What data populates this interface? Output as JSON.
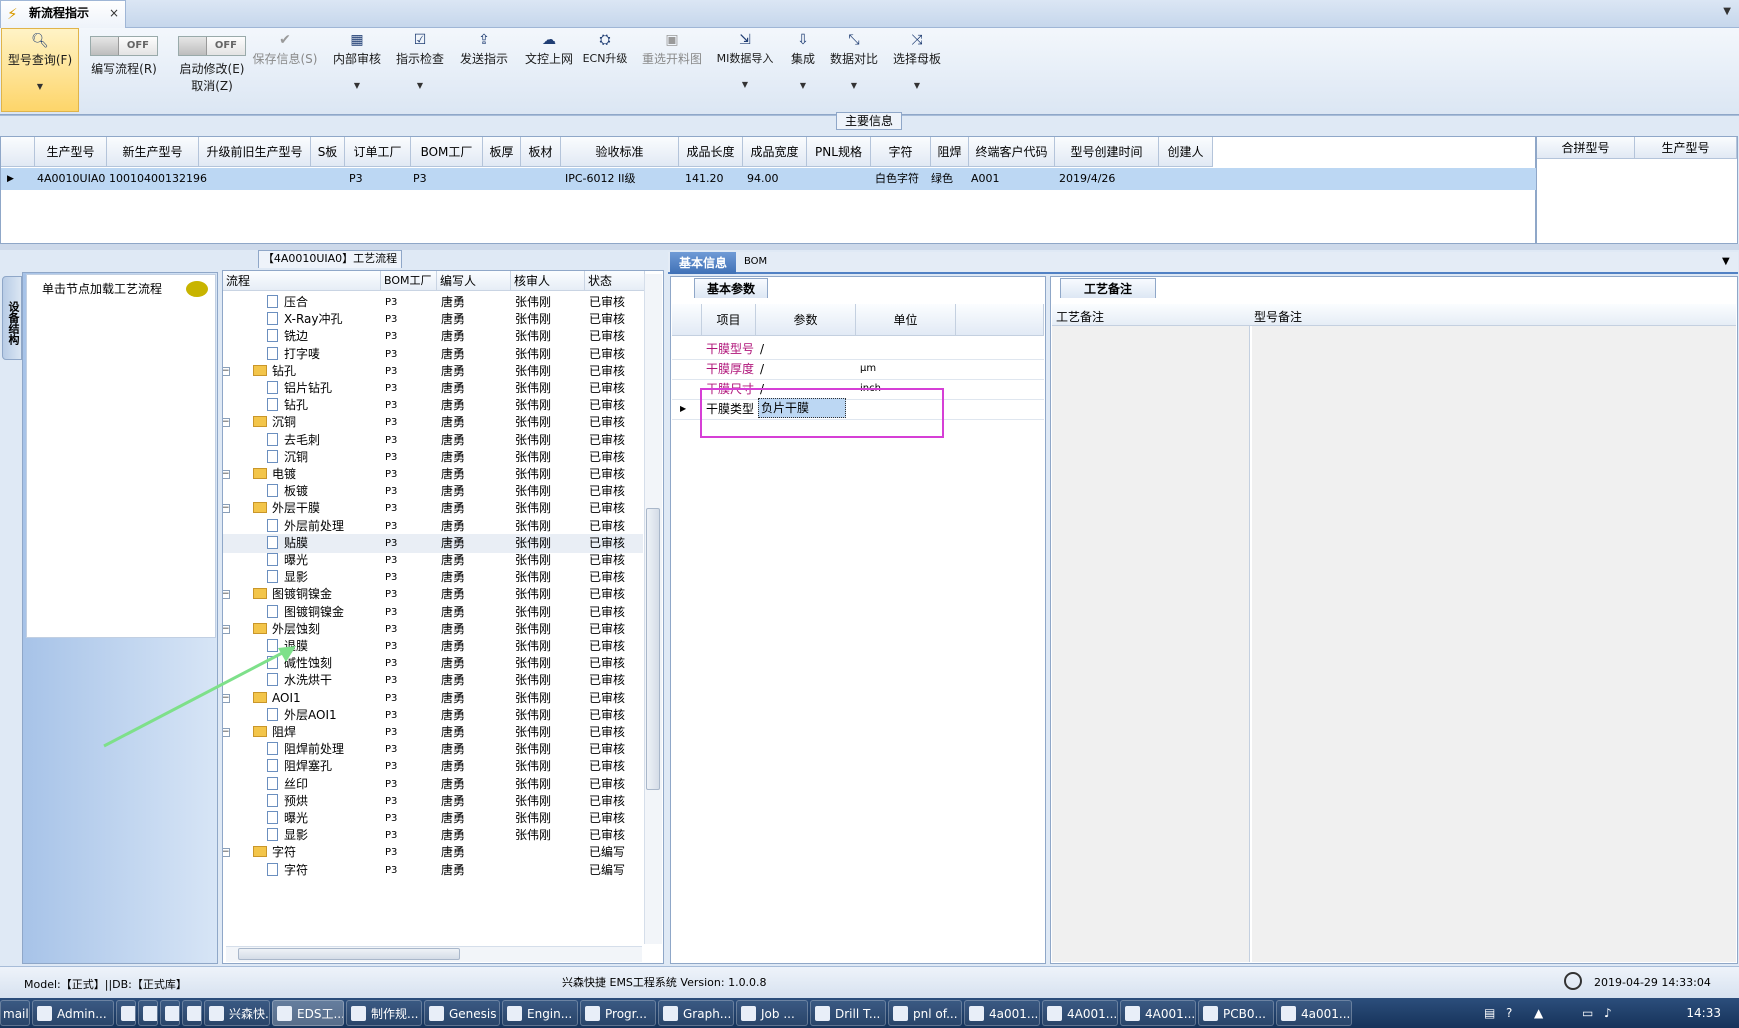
{
  "window": {
    "tab_title": "新流程指示",
    "close": "×",
    "menu_arrow": "▼"
  },
  "ribbon": {
    "search": {
      "label": "型号查询(F)"
    },
    "write_flow": {
      "state": "OFF",
      "label": "编写流程(R)"
    },
    "auto_modify": {
      "state": "OFF",
      "label": "启动修改(E)",
      "label2": "取消(Z)"
    },
    "save": {
      "label": "保存信息(S)"
    },
    "internal_audit": {
      "label": "内部审核"
    },
    "check": {
      "label": "指示检查"
    },
    "send": {
      "label": "发送指示"
    },
    "upload": {
      "label": "文控上网"
    },
    "ecn": {
      "label": "ECN升级"
    },
    "reselect": {
      "label": "重选开料图"
    },
    "mi_import": {
      "label": "MI数据导入"
    },
    "integrate": {
      "label": "集成"
    },
    "compare": {
      "label": "数据对比"
    },
    "mother": {
      "label": "选择母板"
    }
  },
  "main_info": {
    "label": "主要信息",
    "columns": [
      "生产型号",
      "新生产型号",
      "升级前旧生产型号",
      "S板",
      "订单工厂",
      "BOM工厂",
      "板厚",
      "板材",
      "验收标准",
      "成品长度",
      "成品宽度",
      "PNL规格",
      "字符",
      "阻焊",
      "终端客户代码",
      "型号创建时间",
      "创建人"
    ],
    "row": {
      "prod": "4A0010UIA0",
      "newprod": "10010400132196",
      "oldprod": "",
      "s": "",
      "order_factory": "P3",
      "bom_factory": "P3",
      "thickness": "",
      "material": "",
      "standard": "IPC-6012 II级",
      "length": "141.20",
      "width": "94.00",
      "pnl": "",
      "char": "白色字符",
      "mask": "绿色",
      "customer": "A001",
      "created": "2019/4/26",
      "creator": ""
    },
    "right_columns": [
      "合拼型号",
      "生产型号"
    ]
  },
  "left_panel": {
    "side_tab": "设备结构",
    "hint": "单击节点加载工艺流程"
  },
  "tree": {
    "title": "【4A0010UIA0】工艺流程",
    "columns": [
      "流程",
      "BOM工厂",
      "编写人",
      "核审人",
      "状态"
    ],
    "rows": [
      {
        "level": 2,
        "type": "doc",
        "name": "压合",
        "factory": "P3",
        "writer": "唐勇",
        "auditor": "张伟刚",
        "status": "已审核"
      },
      {
        "level": 2,
        "type": "doc",
        "name": "X-Ray冲孔",
        "factory": "P3",
        "writer": "唐勇",
        "auditor": "张伟刚",
        "status": "已审核"
      },
      {
        "level": 2,
        "type": "doc",
        "name": "铣边",
        "factory": "P3",
        "writer": "唐勇",
        "auditor": "张伟刚",
        "status": "已审核"
      },
      {
        "level": 2,
        "type": "doc",
        "name": "打字唛",
        "factory": "P3",
        "writer": "唐勇",
        "auditor": "张伟刚",
        "status": "已审核"
      },
      {
        "level": 1,
        "type": "folder",
        "name": "钻孔",
        "factory": "P3",
        "writer": "唐勇",
        "auditor": "张伟刚",
        "status": "已审核"
      },
      {
        "level": 2,
        "type": "doc",
        "name": "铝片钻孔",
        "factory": "P3",
        "writer": "唐勇",
        "auditor": "张伟刚",
        "status": "已审核"
      },
      {
        "level": 2,
        "type": "doc",
        "name": "钻孔",
        "factory": "P3",
        "writer": "唐勇",
        "auditor": "张伟刚",
        "status": "已审核"
      },
      {
        "level": 1,
        "type": "folder",
        "name": "沉铜",
        "factory": "P3",
        "writer": "唐勇",
        "auditor": "张伟刚",
        "status": "已审核"
      },
      {
        "level": 2,
        "type": "doc",
        "name": "去毛刺",
        "factory": "P3",
        "writer": "唐勇",
        "auditor": "张伟刚",
        "status": "已审核"
      },
      {
        "level": 2,
        "type": "doc",
        "name": "沉铜",
        "factory": "P3",
        "writer": "唐勇",
        "auditor": "张伟刚",
        "status": "已审核"
      },
      {
        "level": 1,
        "type": "folder",
        "name": "电镀",
        "factory": "P3",
        "writer": "唐勇",
        "auditor": "张伟刚",
        "status": "已审核"
      },
      {
        "level": 2,
        "type": "doc",
        "name": "板镀",
        "factory": "P3",
        "writer": "唐勇",
        "auditor": "张伟刚",
        "status": "已审核"
      },
      {
        "level": 1,
        "type": "folder",
        "name": "外层干膜",
        "factory": "P3",
        "writer": "唐勇",
        "auditor": "张伟刚",
        "status": "已审核"
      },
      {
        "level": 2,
        "type": "doc",
        "name": "外层前处理",
        "factory": "P3",
        "writer": "唐勇",
        "auditor": "张伟刚",
        "status": "已审核"
      },
      {
        "level": 2,
        "type": "doc",
        "name": "贴膜",
        "factory": "P3",
        "writer": "唐勇",
        "auditor": "张伟刚",
        "status": "已审核",
        "selected": true
      },
      {
        "level": 2,
        "type": "doc",
        "name": "曝光",
        "factory": "P3",
        "writer": "唐勇",
        "auditor": "张伟刚",
        "status": "已审核"
      },
      {
        "level": 2,
        "type": "doc",
        "name": "显影",
        "factory": "P3",
        "writer": "唐勇",
        "auditor": "张伟刚",
        "status": "已审核"
      },
      {
        "level": 1,
        "type": "folder",
        "name": "图镀铜镍金",
        "factory": "P3",
        "writer": "唐勇",
        "auditor": "张伟刚",
        "status": "已审核"
      },
      {
        "level": 2,
        "type": "doc",
        "name": "图镀铜镍金",
        "factory": "P3",
        "writer": "唐勇",
        "auditor": "张伟刚",
        "status": "已审核"
      },
      {
        "level": 1,
        "type": "folder",
        "name": "外层蚀刻",
        "factory": "P3",
        "writer": "唐勇",
        "auditor": "张伟刚",
        "status": "已审核"
      },
      {
        "level": 2,
        "type": "doc",
        "name": "退膜",
        "factory": "P3",
        "writer": "唐勇",
        "auditor": "张伟刚",
        "status": "已审核"
      },
      {
        "level": 2,
        "type": "doc",
        "name": "碱性蚀刻",
        "factory": "P3",
        "writer": "唐勇",
        "auditor": "张伟刚",
        "status": "已审核"
      },
      {
        "level": 2,
        "type": "doc",
        "name": "水洗烘干",
        "factory": "P3",
        "writer": "唐勇",
        "auditor": "张伟刚",
        "status": "已审核"
      },
      {
        "level": 1,
        "type": "folder",
        "name": "AOI1",
        "factory": "P3",
        "writer": "唐勇",
        "auditor": "张伟刚",
        "status": "已审核"
      },
      {
        "level": 2,
        "type": "doc",
        "name": "外层AOI1",
        "factory": "P3",
        "writer": "唐勇",
        "auditor": "张伟刚",
        "status": "已审核"
      },
      {
        "level": 1,
        "type": "folder",
        "name": "阻焊",
        "factory": "P3",
        "writer": "唐勇",
        "auditor": "张伟刚",
        "status": "已审核"
      },
      {
        "level": 2,
        "type": "doc",
        "name": "阻焊前处理",
        "factory": "P3",
        "writer": "唐勇",
        "auditor": "张伟刚",
        "status": "已审核"
      },
      {
        "level": 2,
        "type": "doc",
        "name": "阻焊塞孔",
        "factory": "P3",
        "writer": "唐勇",
        "auditor": "张伟刚",
        "status": "已审核"
      },
      {
        "level": 2,
        "type": "doc",
        "name": "丝印",
        "factory": "P3",
        "writer": "唐勇",
        "auditor": "张伟刚",
        "status": "已审核"
      },
      {
        "level": 2,
        "type": "doc",
        "name": "预烘",
        "factory": "P3",
        "writer": "唐勇",
        "auditor": "张伟刚",
        "status": "已审核"
      },
      {
        "level": 2,
        "type": "doc",
        "name": "曝光",
        "factory": "P3",
        "writer": "唐勇",
        "auditor": "张伟刚",
        "status": "已审核"
      },
      {
        "level": 2,
        "type": "doc",
        "name": "显影",
        "factory": "P3",
        "writer": "唐勇",
        "auditor": "张伟刚",
        "status": "已审核"
      },
      {
        "level": 1,
        "type": "folder",
        "name": "字符",
        "factory": "P3",
        "writer": "唐勇",
        "auditor": "",
        "status": "已编写"
      },
      {
        "level": 2,
        "type": "doc",
        "name": "字符",
        "factory": "P3",
        "writer": "唐勇",
        "auditor": "",
        "status": "已编写"
      }
    ]
  },
  "right_tabs": {
    "basic": "基本信息",
    "bom": "BOM"
  },
  "basic_params": {
    "sub_tab": "基本参数",
    "columns": [
      "项目",
      "参数",
      "单位"
    ],
    "rows": [
      {
        "item": "干膜型号",
        "param": "/",
        "unit": ""
      },
      {
        "item": "干膜厚度",
        "param": "/",
        "unit": "μm"
      },
      {
        "item": "干膜尺寸",
        "param": "/",
        "unit": "inch"
      },
      {
        "item": "干膜类型",
        "param": "负片干膜",
        "unit": ""
      }
    ]
  },
  "remarks": {
    "sub_tab": "工艺备注",
    "col1": "工艺备注",
    "col2": "型号备注"
  },
  "statusbar": {
    "left": "Model:【正式】||DB:【正式库】",
    "center": "兴森快捷 EMS工程系统 Version: 1.0.0.8",
    "time": "2019-04-29 14:33:04"
  },
  "taskbar": {
    "items": [
      "mail",
      "Admin...",
      "",
      "",
      "",
      "",
      "兴森快...",
      "EDS工...",
      "制作规...",
      "Genesis",
      "Engin...",
      "Progr...",
      "Graph...",
      "Job ...",
      "Drill T...",
      "pnl of...",
      "4a001...",
      "4A001...",
      "4A001...",
      "PCB0...",
      "4a001..."
    ],
    "clock": "14:33"
  },
  "colors": {
    "accent": "#3f70b6",
    "selected_row": "#bcd7f3",
    "highlight": "#d63fd6",
    "pink_label": "#b0157a",
    "arrow": "#7ee08a"
  }
}
